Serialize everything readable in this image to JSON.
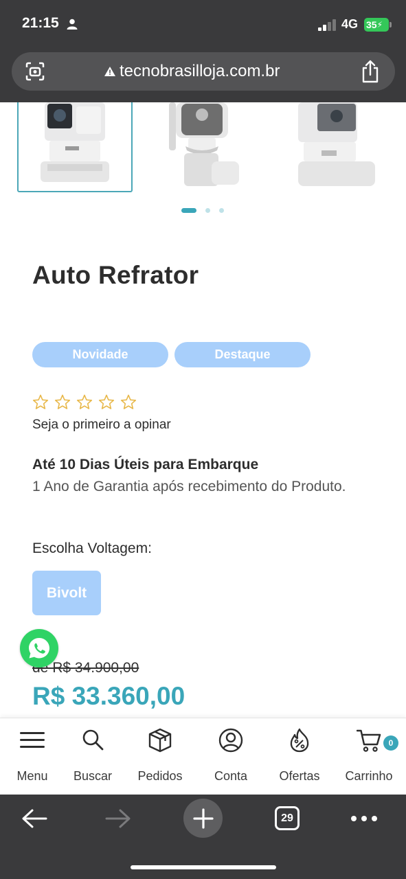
{
  "status_bar": {
    "time": "21:15",
    "network": "4G",
    "battery": "35"
  },
  "browser": {
    "url": "tecnobrasilloja.com.br",
    "tab_count": "29"
  },
  "gallery": {
    "image_count": 3,
    "active_index": 0
  },
  "product": {
    "title": "Auto Refrator",
    "tags": [
      "Novidade",
      "Destaque"
    ],
    "rating_stars": 5,
    "rating_value": 0,
    "review_prompt": "Seja o primeiro a opinar",
    "shipping": "Até 10 Dias Úteis para Embarque",
    "warranty": "1 Ano de Garantia após recebimento do Produto.",
    "voltage_label": "Escolha Voltagem:",
    "voltage_option": "Bivolt",
    "old_price": "de R$ 34.900,00",
    "price": "R$ 33.360,00"
  },
  "bottom_nav": {
    "items": [
      {
        "label": "Menu",
        "icon": "menu-icon"
      },
      {
        "label": "Buscar",
        "icon": "search-icon"
      },
      {
        "label": "Pedidos",
        "icon": "box-icon"
      },
      {
        "label": "Conta",
        "icon": "user-icon"
      },
      {
        "label": "Ofertas",
        "icon": "flame-percent-icon"
      },
      {
        "label": "Carrinho",
        "icon": "cart-icon"
      }
    ],
    "cart_count": "0"
  },
  "colors": {
    "accent": "#3aa6b9",
    "tag_bg": "#a8cffb",
    "star": "#e8b84a",
    "whatsapp": "#2fd365",
    "chrome": "#3a3a3c"
  }
}
